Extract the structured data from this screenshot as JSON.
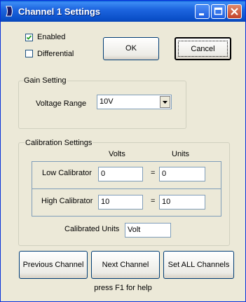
{
  "window": {
    "title": "Channel 1 Settings"
  },
  "options": {
    "enabled": {
      "label": "Enabled",
      "checked": true
    },
    "differential": {
      "label": "Differential",
      "checked": false
    }
  },
  "buttons": {
    "ok": "OK",
    "cancel": "Cancel",
    "previous_channel": "Previous Channel",
    "next_channel": "Next Channel",
    "set_all_channels": "Set ALL Channels"
  },
  "gain": {
    "group_title": "Gain Setting",
    "voltage_range_label": "Voltage Range",
    "voltage_range_value": "10V"
  },
  "calibration": {
    "group_title": "Calibration Settings",
    "volts_header": "Volts",
    "units_header": "Units",
    "low": {
      "label": "Low Calibrator",
      "volts": "0",
      "units": "0"
    },
    "high": {
      "label": "High Calibrator",
      "volts": "10",
      "units": "10"
    },
    "equals": "=",
    "calibrated_units_label": "Calibrated Units",
    "calibrated_units_value": "Volt"
  },
  "footer": {
    "help_text": "press F1 for help"
  }
}
